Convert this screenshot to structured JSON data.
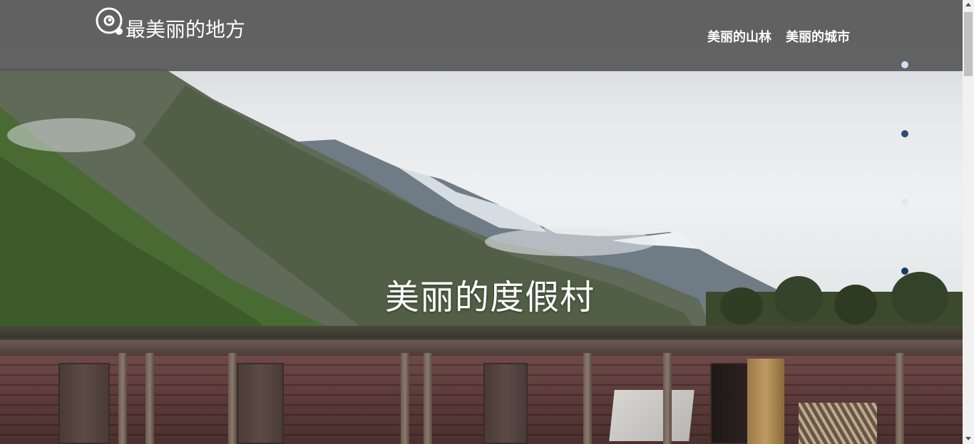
{
  "header": {
    "site_title": "最美丽的地方",
    "logo_icon": "eye-search-icon"
  },
  "nav": {
    "items": [
      {
        "label": "美丽的山林"
      },
      {
        "label": "美丽的城市"
      }
    ]
  },
  "hero": {
    "headline": "美丽的度假村",
    "scene": "mountain-valley-with-log-cabin"
  },
  "carousel": {
    "dots": [
      {
        "color": "#cfe0f4"
      },
      {
        "color": "#2e4a7a"
      },
      {
        "color": "#dde8f6"
      },
      {
        "color": "#183a66"
      }
    ]
  },
  "colors": {
    "header_bg": "#585858",
    "text": "#ffffff"
  }
}
